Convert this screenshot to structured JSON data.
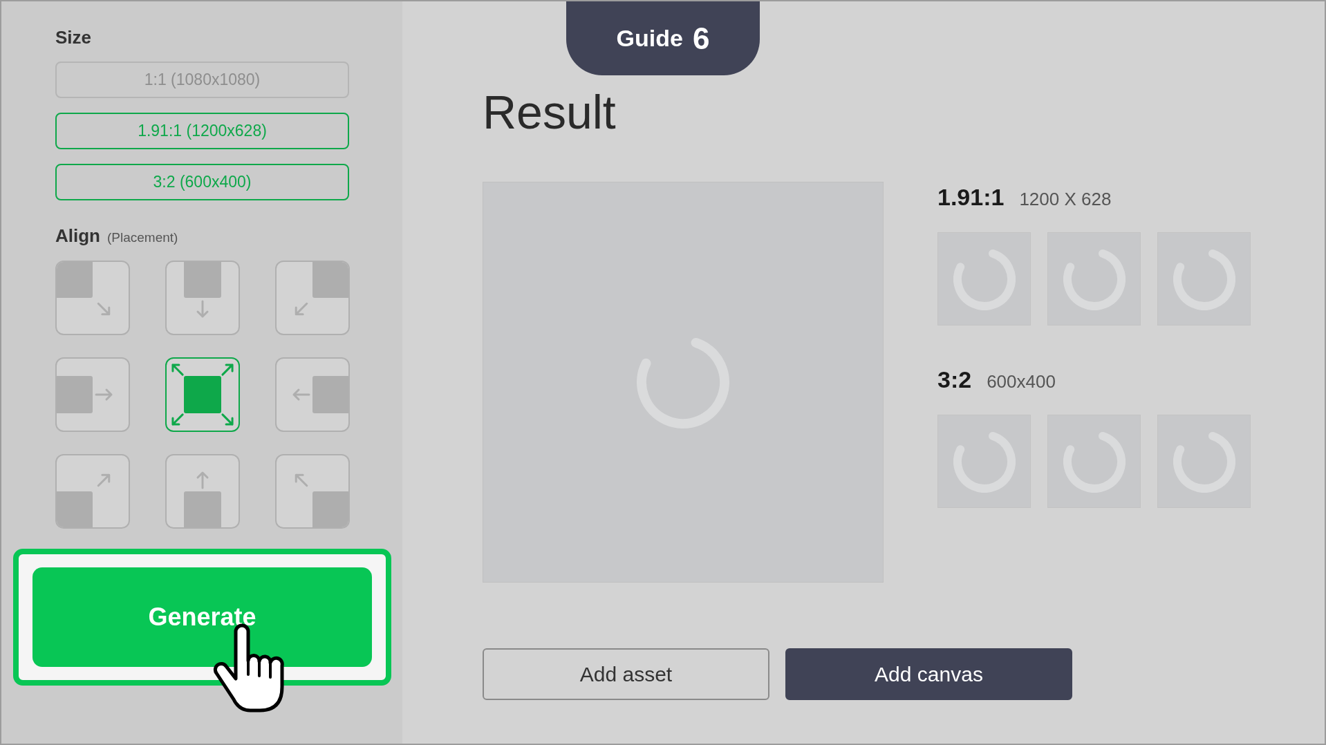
{
  "sidebar": {
    "size_heading": "Size",
    "sizes": [
      {
        "label": "1:1 (1080x1080)",
        "disabled": true
      },
      {
        "label": "1.91:1 (1200x628)",
        "disabled": false
      },
      {
        "label": "3:2 (600x400)",
        "disabled": false
      }
    ],
    "align_heading": "Align",
    "align_note": "(Placement)",
    "align_options": [
      {
        "kind": "top-left",
        "selected": false
      },
      {
        "kind": "top-center",
        "selected": false
      },
      {
        "kind": "top-right",
        "selected": false
      },
      {
        "kind": "middle-left",
        "selected": false
      },
      {
        "kind": "center",
        "selected": true
      },
      {
        "kind": "middle-right",
        "selected": false
      },
      {
        "kind": "bottom-left",
        "selected": false
      },
      {
        "kind": "bottom-center",
        "selected": false
      },
      {
        "kind": "bottom-right",
        "selected": false
      }
    ],
    "generate_button": "Generate"
  },
  "guide": {
    "label": "Guide",
    "step": "6"
  },
  "result": {
    "title": "Result",
    "groups": [
      {
        "ratio": "1.91:1",
        "dimensions": "1200 X 628"
      },
      {
        "ratio": "3:2",
        "dimensions": "600x400"
      }
    ]
  },
  "buttons": [
    {
      "label": "Add asset",
      "kind": "outline"
    },
    {
      "label": "Add canvas",
      "kind": "filled"
    }
  ]
}
